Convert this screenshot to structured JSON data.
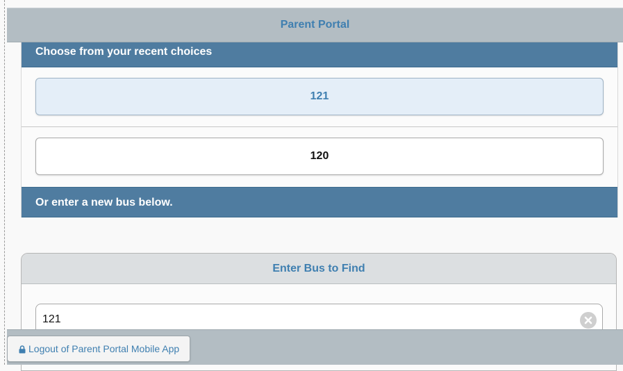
{
  "header": {
    "title": "Parent Portal"
  },
  "recent": {
    "heading": "Choose from your recent choices",
    "choices": [
      {
        "label": "121",
        "selected": true
      },
      {
        "label": "120",
        "selected": false
      }
    ],
    "new_bus_prompt": "Or enter a new bus below."
  },
  "find": {
    "title": "Enter Bus to Find",
    "input_value": "121",
    "clear_icon": "clear-circle-icon"
  },
  "footer": {
    "logout_label": "Logout of Parent Portal Mobile App",
    "logout_icon": "lock-icon"
  },
  "colors": {
    "accent": "#3f7fb0",
    "header_bar": "#b3bdc3",
    "section_header": "#4f7ca0",
    "selected_choice_bg": "#e4eef8"
  }
}
